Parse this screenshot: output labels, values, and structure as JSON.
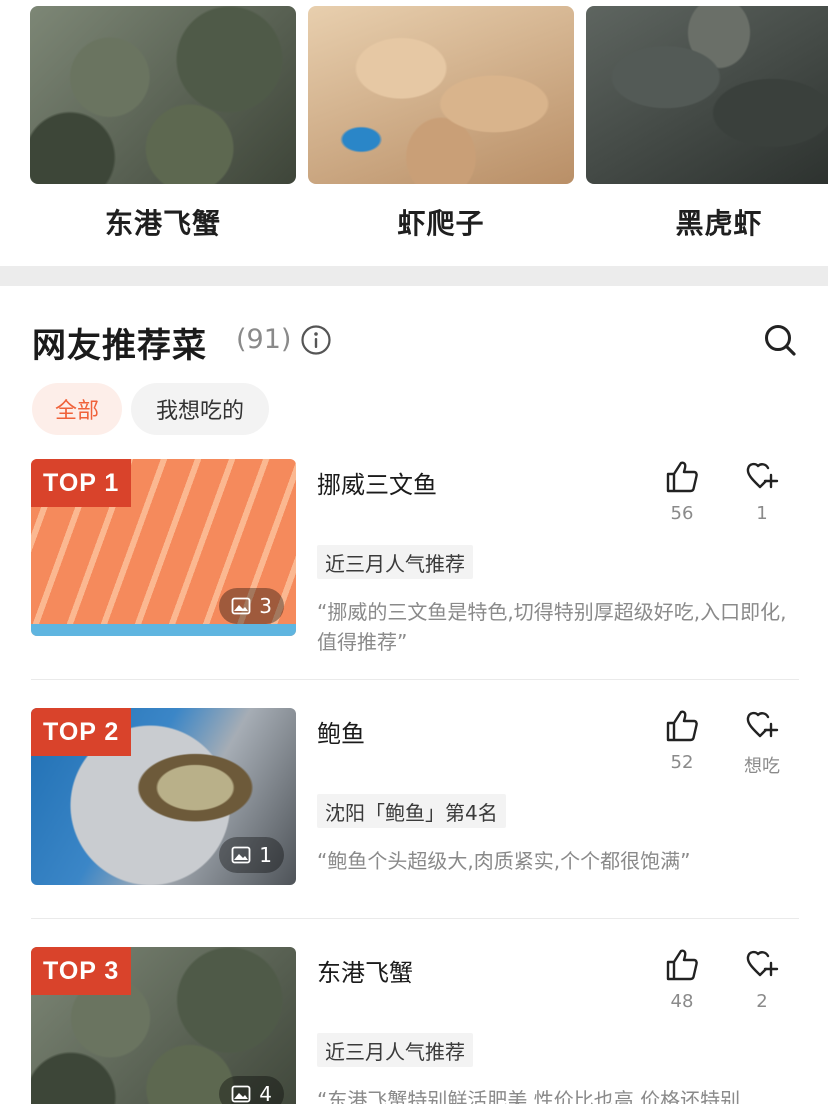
{
  "carousel": {
    "items": [
      {
        "label": "东港飞蟹",
        "image": "crab-photo"
      },
      {
        "label": "虾爬子",
        "image": "mantis-shrimp-photo"
      },
      {
        "label": "黑虎虾",
        "image": "tiger-prawn-photo"
      }
    ]
  },
  "section": {
    "title": "网友推荐菜",
    "count": "(91)"
  },
  "filters": {
    "all": "全部",
    "want": "我想吃的",
    "active": "全部"
  },
  "dishes": [
    {
      "rank": "TOP 1",
      "name": "挪威三文鱼",
      "tag": "近三月人气推荐",
      "quote": "“挪威的三文鱼是特色,切得特别厚超级好吃,入口即化,值得推荐”",
      "photo_count": "3",
      "likes": "56",
      "want": "1"
    },
    {
      "rank": "TOP 2",
      "name": "鲍鱼",
      "tag": "沈阳「鲍鱼」第4名",
      "quote": "“鲍鱼个头超级大,肉质紧实,个个都很饱满”",
      "photo_count": "1",
      "likes": "52",
      "want": "想吃"
    },
    {
      "rank": "TOP 3",
      "name": "东港飞蟹",
      "tag": "近三月人气推荐",
      "quote": "“东港飞蟹特别鲜活肥美,性价比也高,价格还特别",
      "photo_count": "4",
      "likes": "48",
      "want": "2"
    }
  ],
  "colors": {
    "accent": "#f0623a",
    "badge": "#d9432b"
  }
}
